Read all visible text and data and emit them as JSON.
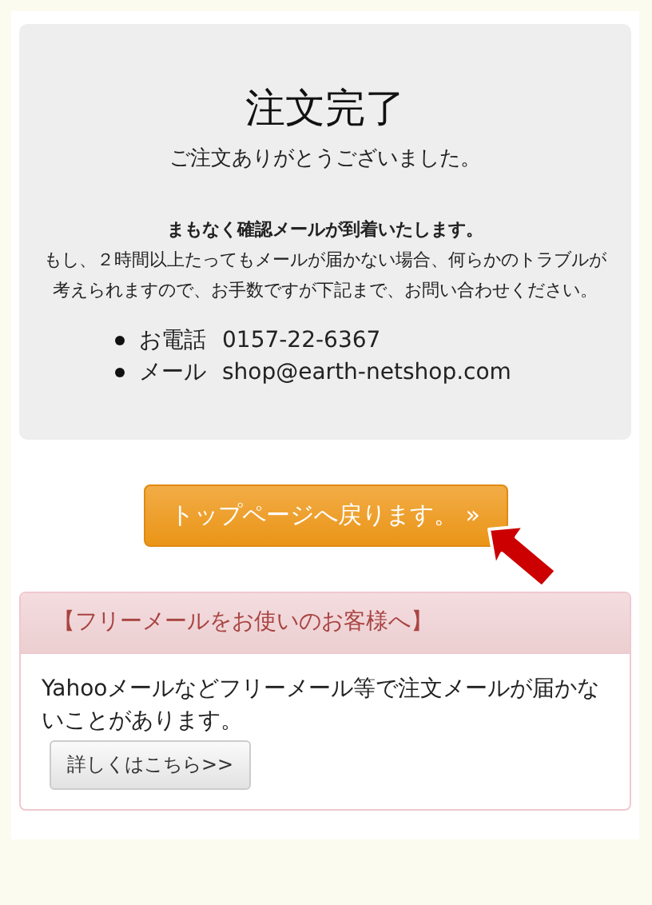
{
  "confirmation": {
    "title": "注文完了",
    "thanks": "ご注文ありがとうございました。",
    "notice": "まもなく確認メールが到着いたします。",
    "message": "もし、２時間以上たってもメールが届かない場合、何らかのトラブルが考えられますので、お手数ですが下記まで、お問い合わせください。",
    "contacts": [
      {
        "label": "お電話",
        "value": "0157-22-6367"
      },
      {
        "label": "メール",
        "value": "shop@earth-netshop.com"
      }
    ]
  },
  "top_button": {
    "label": "トップページへ戻ります。 »"
  },
  "free_mail_panel": {
    "heading": "【フリーメールをお使いのお客様へ】",
    "body": "Yahooメールなどフリーメール等で注文メールが届かないことがあります。",
    "button": "詳しくはこちら>>"
  }
}
